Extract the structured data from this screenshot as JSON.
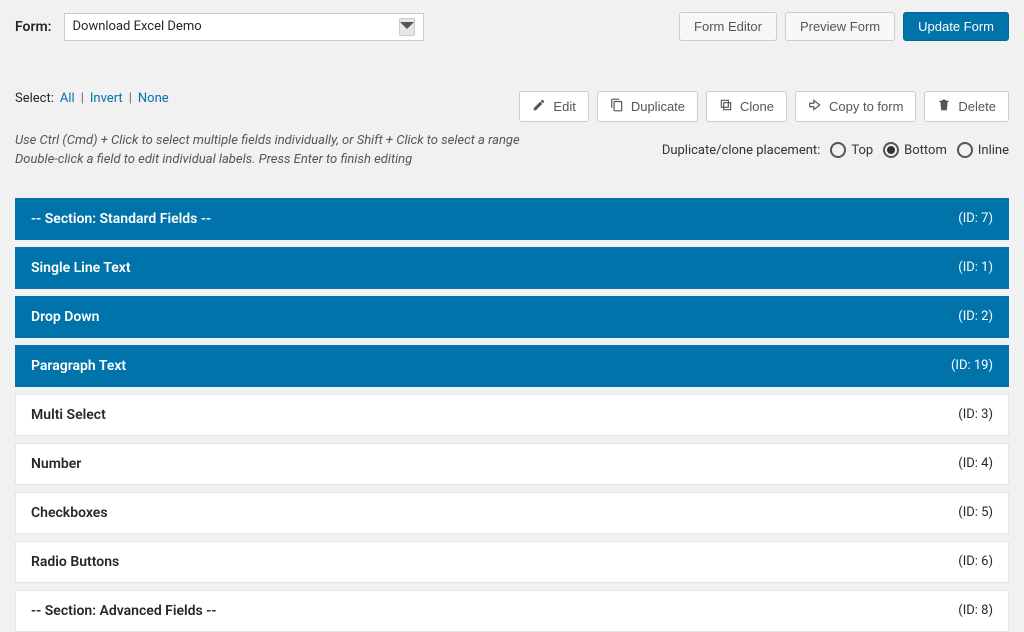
{
  "topbar": {
    "form_label": "Form:",
    "form_name": "Download Excel Demo",
    "buttons": {
      "form_editor": "Form Editor",
      "preview_form": "Preview Form",
      "update_form": "Update Form"
    }
  },
  "select": {
    "label": "Select:",
    "all": "All",
    "invert": "Invert",
    "none": "None"
  },
  "actions": {
    "edit": "Edit",
    "duplicate": "Duplicate",
    "clone": "Clone",
    "copy_to_form": "Copy to form",
    "delete": "Delete"
  },
  "help": {
    "line1": "Use Ctrl (Cmd) + Click to select multiple fields individually, or Shift + Click to select a range",
    "line2": "Double-click a field to edit individual labels. Press Enter to finish editing"
  },
  "placement": {
    "label": "Duplicate/clone placement:",
    "options": {
      "top": "Top",
      "bottom": "Bottom",
      "inline": "Inline"
    },
    "selected": "bottom"
  },
  "fields": [
    {
      "label": "-- Section: Standard Fields --",
      "id": "(ID: 7)",
      "selected": true
    },
    {
      "label": "Single Line Text",
      "id": "(ID: 1)",
      "selected": true
    },
    {
      "label": "Drop Down",
      "id": "(ID: 2)",
      "selected": true
    },
    {
      "label": "Paragraph Text",
      "id": "(ID: 19)",
      "selected": true
    },
    {
      "label": "Multi Select",
      "id": "(ID: 3)",
      "selected": false
    },
    {
      "label": "Number",
      "id": "(ID: 4)",
      "selected": false
    },
    {
      "label": "Checkboxes",
      "id": "(ID: 5)",
      "selected": false
    },
    {
      "label": "Radio Buttons",
      "id": "(ID: 6)",
      "selected": false
    },
    {
      "label": "-- Section: Advanced Fields --",
      "id": "(ID: 8)",
      "selected": false
    }
  ]
}
